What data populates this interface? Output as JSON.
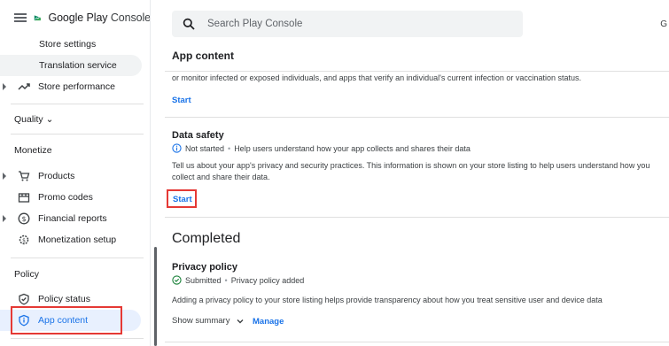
{
  "sidebar": {
    "brand": {
      "prefix": "Google Play",
      "suffix": "Console"
    },
    "items": [
      {
        "label": "Store settings"
      },
      {
        "label": "Translation service"
      },
      {
        "label": "Store performance"
      },
      {
        "label": "Products"
      },
      {
        "label": "Promo codes"
      },
      {
        "label": "Financial reports"
      },
      {
        "label": "Monetization setup"
      },
      {
        "label": "Policy status"
      },
      {
        "label": "App content"
      }
    ],
    "sections": {
      "quality": "Quality ⌄",
      "monetize": "Monetize",
      "policy": "Policy"
    }
  },
  "search": {
    "placeholder": "Search Play Console"
  },
  "topbar": {
    "right_text": "G"
  },
  "main": {
    "header": "App content",
    "truncated_text": "or monitor infected or exposed individuals, and apps that verify an individual's current infection or vaccination status.",
    "start_1": "Start",
    "data_safety": {
      "title": "Data safety",
      "status": "Not started",
      "status_desc": "Help users understand how your app collects and shares their data",
      "desc_line1": "Tell us about your app's privacy and security practices. This information is shown on your store listing to help users understand how you",
      "desc_line2": "collect and share their data.",
      "start": "Start"
    },
    "completed": "Completed",
    "privacy": {
      "title": "Privacy policy",
      "status": "Submitted",
      "status_desc": "Privacy policy added",
      "desc": "Adding a privacy policy to your store listing helps provide transparency about how you treat sensitive user and device data",
      "show_summary": "Show summary",
      "manage": "Manage"
    }
  },
  "colors": {
    "accent": "#1a73e8",
    "highlight": "#e53935",
    "success": "#188038"
  }
}
